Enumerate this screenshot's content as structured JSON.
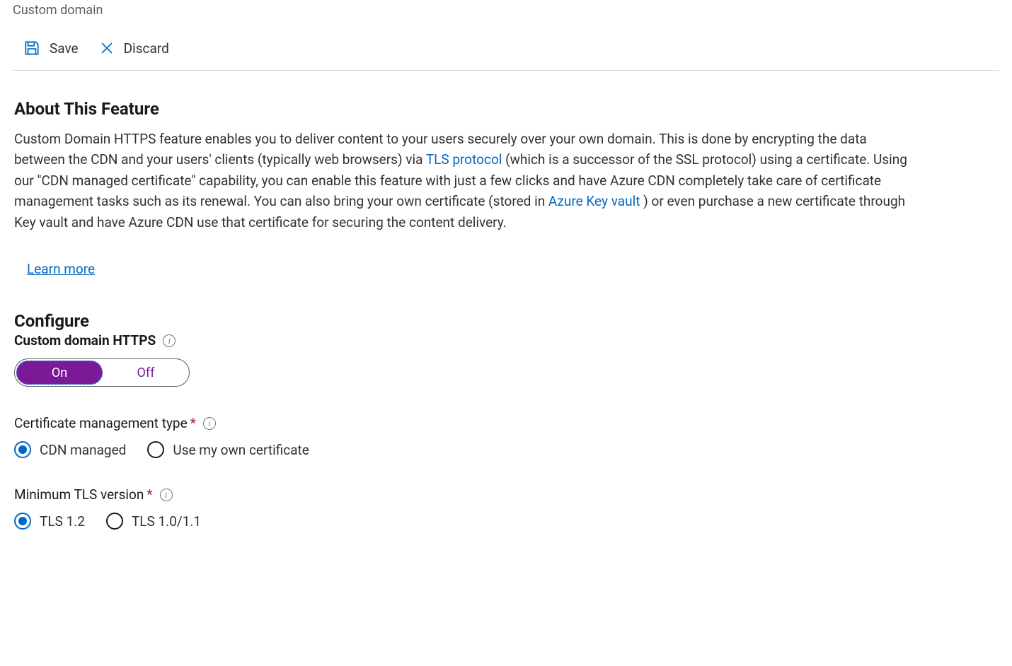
{
  "breadcrumb": "Custom domain",
  "toolbar": {
    "save_label": "Save",
    "discard_label": "Discard"
  },
  "about": {
    "title": "About This Feature",
    "p1a": "Custom Domain HTTPS feature enables you to deliver content to your users securely over your own domain. This is done by encrypting the data between the CDN and your users' clients (typically web browsers) via ",
    "link_tls": "TLS protocol",
    "p1b": " (which is a successor of the SSL protocol) using a certificate. Using our \"CDN managed certificate\" capability, you can enable this feature with just a few clicks and have Azure CDN completely take care of certificate management tasks such as its renewal. You can also bring your own certificate (stored in ",
    "link_akv": "Azure Key vault",
    "p1c": " ) or even purchase a new certificate through Key vault and have Azure CDN use that certificate for securing the content delivery.",
    "learn_more": "Learn more"
  },
  "configure": {
    "title": "Configure",
    "https_label": "Custom domain HTTPS",
    "toggle_on": "On",
    "toggle_off": "Off",
    "cert_label": "Certificate management type",
    "cert_opt1": "CDN managed",
    "cert_opt2": "Use my own certificate",
    "tls_label": "Minimum TLS version",
    "tls_opt1": "TLS 1.2",
    "tls_opt2": "TLS 1.0/1.1",
    "required_mark": "*"
  }
}
